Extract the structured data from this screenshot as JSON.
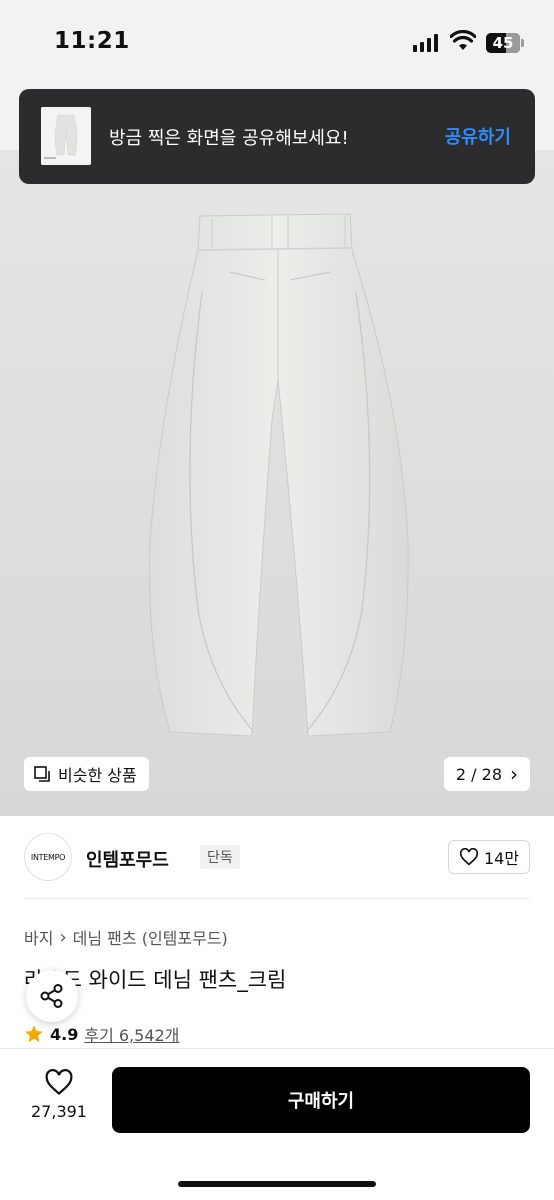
{
  "status": {
    "time": "11:21",
    "battery": "45",
    "icons": [
      "signal-icon",
      "wifi-icon",
      "battery-icon"
    ]
  },
  "share_banner": {
    "message": "방금 찍은 화면을 공유해보세요!",
    "action": "공유하기",
    "action_color": "#2f8cff"
  },
  "image_controls": {
    "similar_label": "비슷한 상품",
    "page_indicator": "2 / 28",
    "chevron": "›"
  },
  "brand": {
    "logo_text": "INTEMPO",
    "name": "인템포무드",
    "tag": "단독",
    "likes": "14만"
  },
  "breadcrumb": {
    "items": [
      "바지",
      "데님 팬츠 (인템포무드)"
    ],
    "separator": "›"
  },
  "product": {
    "title": "라운드 와이드 데님 팬츠_크림",
    "rating": "4.9",
    "review_text": "후기 6,542개"
  },
  "bottom_bar": {
    "wish_count": "27,391",
    "buy_label": "구매하기"
  },
  "colors": {
    "banner_bg": "#2c2c2e",
    "buy_bg": "#000000",
    "star": "#f2a900"
  }
}
